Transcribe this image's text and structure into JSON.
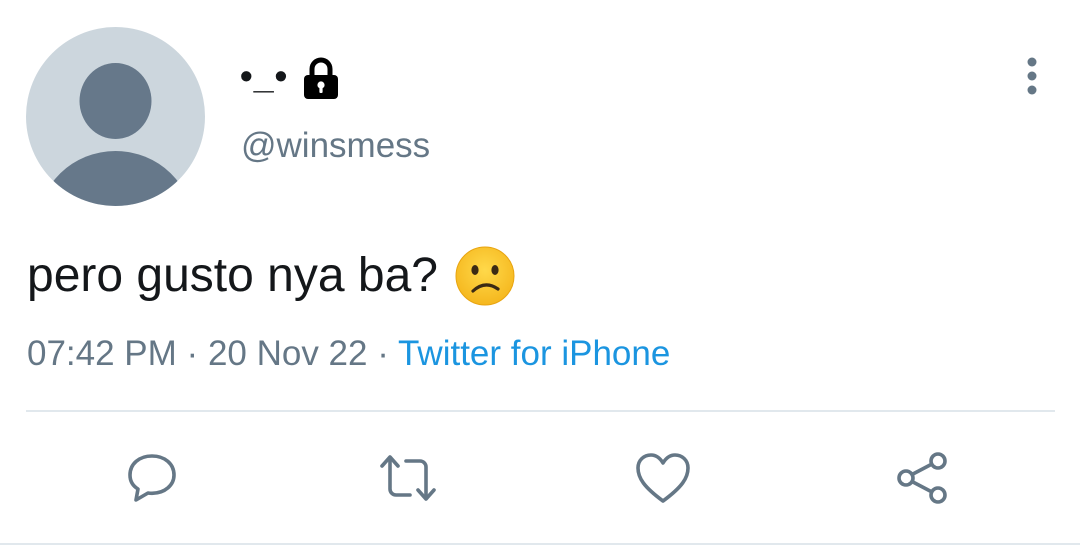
{
  "tweet": {
    "display_name": "•_•",
    "handle": "@winsmess",
    "text": "pero gusto nya ba?",
    "time": "07:42 PM",
    "separator": "·",
    "date": "20 Nov 22",
    "source": "Twitter for iPhone"
  },
  "icons": {
    "lock": "lock-icon",
    "more": "vertical-ellipsis-icon",
    "emoji": "slightly-frowning-face-emoji",
    "reply": "speech-bubble-icon",
    "retweet": "retweet-arrows-icon",
    "like": "heart-icon",
    "share": "share-nodes-icon"
  },
  "colors": {
    "text": "#14171a",
    "secondary": "#657786",
    "link": "#1b95e0",
    "divider": "#e1e8ed",
    "avatar_bg": "#ccd6dd",
    "avatar_fg": "#66788a"
  }
}
